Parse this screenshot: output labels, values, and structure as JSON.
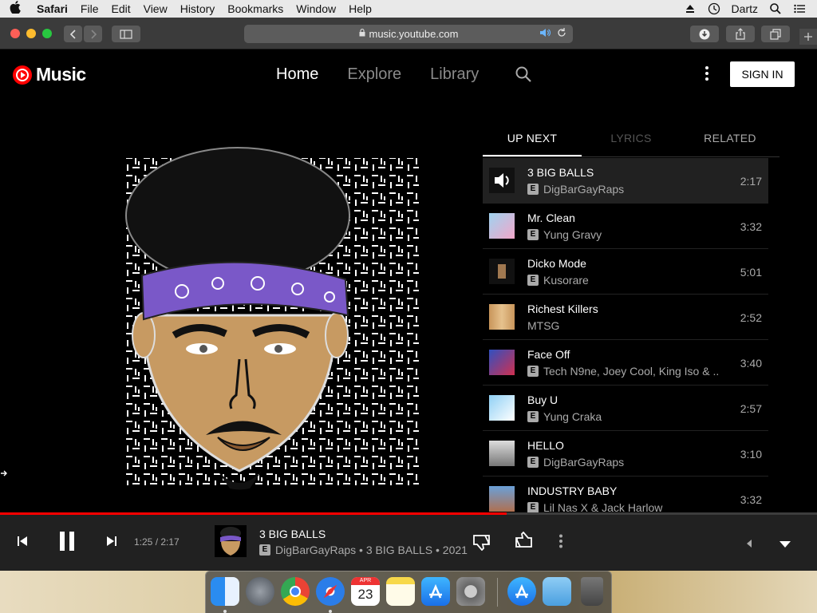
{
  "menubar": {
    "app_name": "Safari",
    "items": [
      "File",
      "Edit",
      "View",
      "History",
      "Bookmarks",
      "Window",
      "Help"
    ],
    "user_name": "Dartz"
  },
  "safari": {
    "url": "music.youtube.com"
  },
  "ytmusic": {
    "logo_text": "Music",
    "nav": {
      "home": "Home",
      "explore": "Explore",
      "library": "Library"
    },
    "sign_in": "SIGN IN",
    "panel_tabs": {
      "up_next": "UP NEXT",
      "lyrics": "LYRICS",
      "related": "RELATED"
    },
    "explicit_badge": "E",
    "queue": [
      {
        "title": "3 BIG BALLS",
        "artist": "DigBarGayRaps",
        "duration": "2:17",
        "explicit": true,
        "playing": true
      },
      {
        "title": "Mr. Clean",
        "artist": "Yung Gravy",
        "duration": "3:32",
        "explicit": true
      },
      {
        "title": "Dicko Mode",
        "artist": "Kusorare",
        "duration": "5:01",
        "explicit": true
      },
      {
        "title": "Richest Killers",
        "artist": "MTSG",
        "duration": "2:52",
        "explicit": false
      },
      {
        "title": "Face Off",
        "artist": "Tech N9ne, Joey Cool, King Iso & ...",
        "duration": "3:40",
        "explicit": true
      },
      {
        "title": "Buy U",
        "artist": "Yung Craka",
        "duration": "2:57",
        "explicit": true
      },
      {
        "title": "HELLO",
        "artist": "DigBarGayRaps",
        "duration": "3:10",
        "explicit": true
      },
      {
        "title": "INDUSTRY BABY",
        "artist": "Lil Nas X & Jack Harlow",
        "duration": "3:32",
        "explicit": true
      }
    ],
    "player": {
      "time": "1:25 / 2:17",
      "progress_fraction": 0.62,
      "title": "3 BIG BALLS",
      "subtitle": "DigBarGayRaps • 3 BIG BALLS • 2021"
    }
  },
  "dock": {
    "calendar_month": "APR",
    "calendar_day": "23"
  },
  "colors": {
    "accent": "#ff0000",
    "background": "#000000",
    "player_bar": "#212121"
  }
}
